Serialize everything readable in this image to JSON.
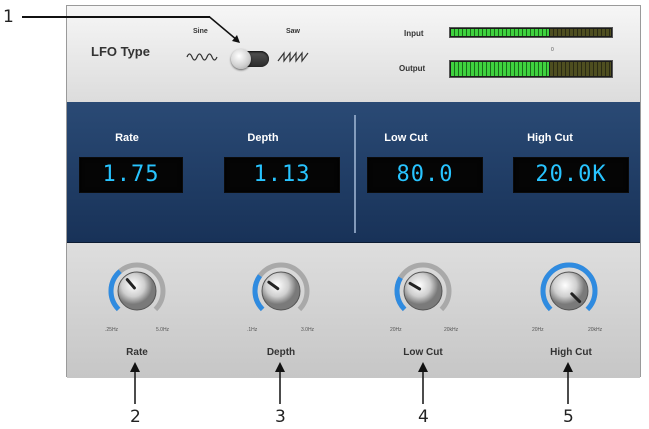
{
  "callouts": [
    "1",
    "2",
    "3",
    "4",
    "5"
  ],
  "lfo": {
    "label": "LFO Type",
    "option_left": "Sine",
    "option_right": "Saw",
    "toggle_position": "sine"
  },
  "meters": {
    "input_label": "Input",
    "output_label": "Output",
    "scale_marker": "0",
    "input_level": 0.62,
    "output_level": 0.62
  },
  "displays": [
    {
      "title": "Rate",
      "value": "1.75"
    },
    {
      "title": "Depth",
      "value": "1.13"
    },
    {
      "title": "Low Cut",
      "value": "80.0"
    },
    {
      "title": "High Cut",
      "value": "20.0K"
    }
  ],
  "knobs": [
    {
      "name": "Rate",
      "min_label": ".25Hz",
      "max_label": "5.0Hz",
      "level": 0.35
    },
    {
      "name": "Depth",
      "min_label": ".1Hz",
      "max_label": "3.0Hz",
      "level": 0.3
    },
    {
      "name": "Low Cut",
      "min_label": "20Hz",
      "max_label": "20kHz",
      "level": 0.28
    },
    {
      "name": "High Cut",
      "min_label": "20Hz",
      "max_label": "20kHz",
      "level": 1.0
    }
  ],
  "colors": {
    "display_text": "#28c4ff",
    "display_bg": "#183258",
    "knob_arc": "#2f8be0",
    "meter_green": "#3fd23f"
  }
}
